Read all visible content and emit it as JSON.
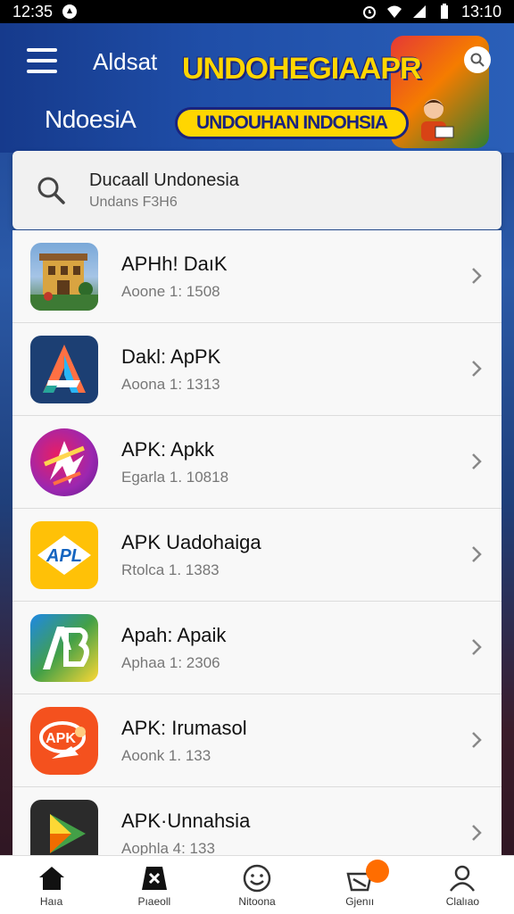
{
  "status_bar": {
    "time_left": "12:35",
    "time_right": "13:10"
  },
  "header": {
    "title": "Aldsat",
    "subtitle": "NdoesiA",
    "banner_headline": "UNDOHEGIAAPR",
    "banner_pill": "UNDOUHAN INDOHSIA"
  },
  "search": {
    "title": "Ducaall Undonesia",
    "subtitle": "Undans F3H6"
  },
  "apps": [
    {
      "name": "APHh! DaıK",
      "meta": "Aoone 1: 1508",
      "icon": "building-photo-icon"
    },
    {
      "name": "Dakl: ApPK",
      "meta": "Aoona 1: 1313",
      "icon": "letter-a-icon"
    },
    {
      "name": "APK: Apkk",
      "meta": "Egarla 1. 10818",
      "icon": "star-swirl-icon"
    },
    {
      "name": "APK Uadohaiga",
      "meta": "Rtolca 1. 1383",
      "icon": "apl-badge-icon"
    },
    {
      "name": "Apah: Apaik",
      "meta": "Aphaa 1: 2306",
      "icon": "ab-letters-icon"
    },
    {
      "name": "APK: Irumasol",
      "meta": "Aoonk 1. 133",
      "icon": "apk-bubble-icon"
    },
    {
      "name": "APK·Unnahsia",
      "meta": "Aophla 4: 133",
      "icon": "play-triangle-icon"
    }
  ],
  "bottom_nav": [
    {
      "label": "Haıa",
      "icon": "home-icon"
    },
    {
      "label": "Pıaeoll",
      "icon": "store-icon"
    },
    {
      "label": "Nitoona",
      "icon": "smile-icon"
    },
    {
      "label": "Gjenıı",
      "icon": "inbox-icon"
    },
    {
      "label": "Clalıao",
      "icon": "profile-icon"
    }
  ],
  "colors": {
    "header": "#1f4ea8",
    "banner_yellow": "#ffd600",
    "badge": "#ff6d00"
  }
}
